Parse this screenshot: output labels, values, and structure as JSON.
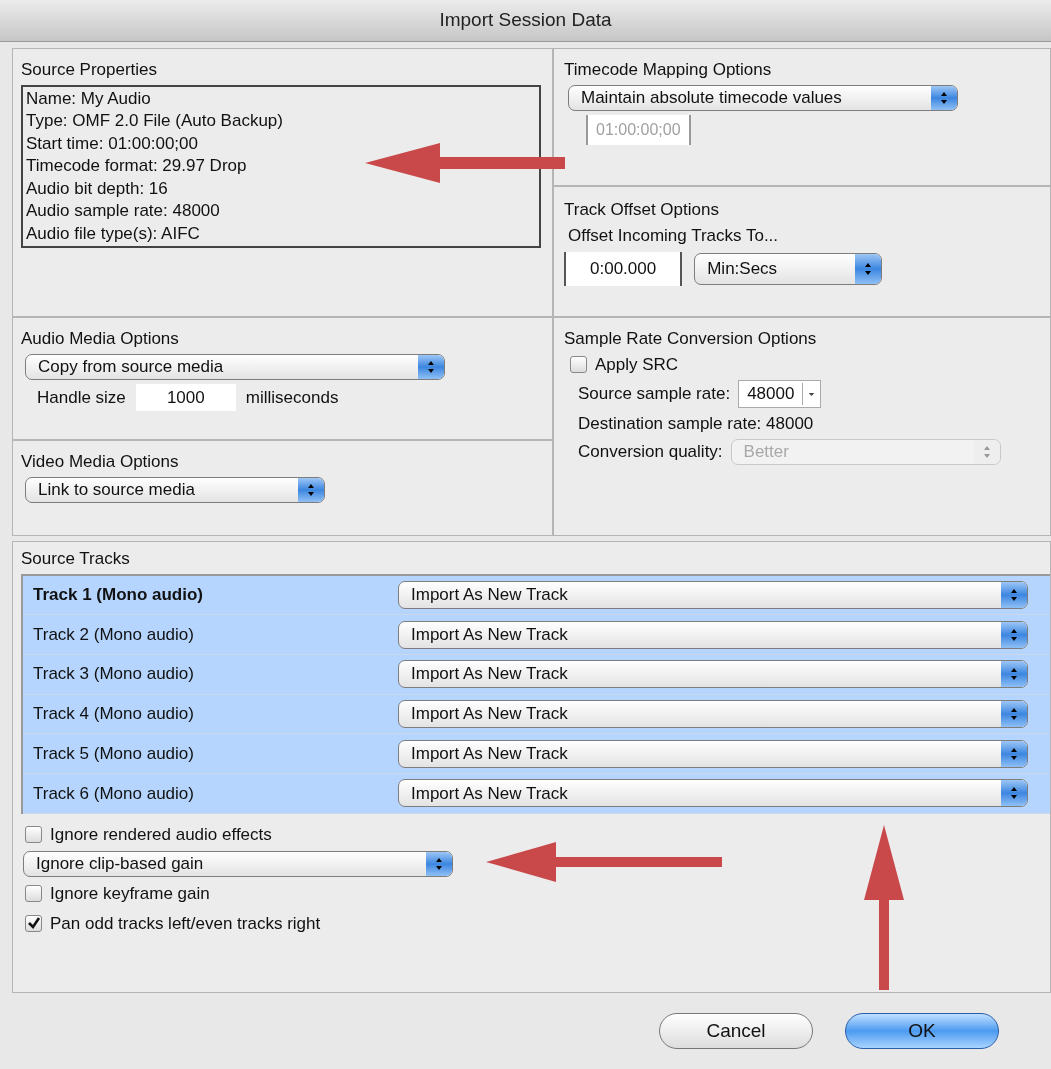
{
  "window": {
    "title": "Import Session Data"
  },
  "source_properties": {
    "title": "Source Properties",
    "lines": [
      "Name: My Audio",
      "Type: OMF 2.0 File (Auto Backup)",
      "Start time: 01:00:00;00",
      "Timecode format: 29.97 Drop",
      "Audio bit depth: 16",
      "Audio sample rate: 48000",
      "Audio file type(s): AIFC"
    ]
  },
  "timecode_mapping": {
    "title": "Timecode Mapping Options",
    "popup": {
      "value": "Maintain absolute timecode values",
      "disabled": false
    },
    "timecode": {
      "value": "01:00:00;00",
      "disabled": true
    }
  },
  "track_offset": {
    "title": "Track Offset Options",
    "label": "Offset Incoming Tracks To...",
    "offset": {
      "value": "0:00.000"
    },
    "units": {
      "value": "Min:Secs",
      "disabled": false
    }
  },
  "audio_media": {
    "title": "Audio Media Options",
    "popup": {
      "value": "Copy from source media",
      "disabled": false
    },
    "handle_label": "Handle size",
    "handle_value": "1000",
    "handle_units": "milliseconds"
  },
  "video_media": {
    "title": "Video Media Options",
    "popup": {
      "value": "Link to source media",
      "disabled": false
    }
  },
  "sample_rate": {
    "title": "Sample Rate Conversion Options",
    "apply": {
      "label": "Apply SRC",
      "checked": false
    },
    "source_label": "Source sample rate:",
    "source_value": "48000",
    "destination": "Destination sample rate: 48000",
    "quality_label": "Conversion quality:",
    "quality": {
      "value": "Better",
      "disabled": true
    }
  },
  "source_tracks": {
    "title": "Source Tracks",
    "rows": [
      {
        "name": "Track 1 (Mono audio)",
        "action": "Import As New Track",
        "selected": true,
        "focused": true
      },
      {
        "name": "Track 2 (Mono audio)",
        "action": "Import As New Track",
        "selected": true,
        "focused": false
      },
      {
        "name": "Track 3 (Mono audio)",
        "action": "Import As New Track",
        "selected": true,
        "focused": false
      },
      {
        "name": "Track 4 (Mono audio)",
        "action": "Import As New Track",
        "selected": true,
        "focused": false
      },
      {
        "name": "Track 5 (Mono audio)",
        "action": "Import As New Track",
        "selected": true,
        "focused": false
      },
      {
        "name": "Track 6 (Mono audio)",
        "action": "Import As New Track",
        "selected": true,
        "focused": false
      }
    ]
  },
  "options": [
    {
      "kind": "checkbox",
      "label": "Ignore rendered audio effects",
      "checked": false
    },
    {
      "kind": "popup",
      "value": "Ignore clip-based gain",
      "disabled": false
    },
    {
      "kind": "checkbox",
      "label": "Ignore keyframe gain",
      "checked": false
    },
    {
      "kind": "checkbox",
      "label": "Pan odd tracks left/even tracks right",
      "checked": true
    }
  ],
  "buttons": [
    {
      "label": "Cancel",
      "default": false
    },
    {
      "label": "OK",
      "default": true
    }
  ]
}
